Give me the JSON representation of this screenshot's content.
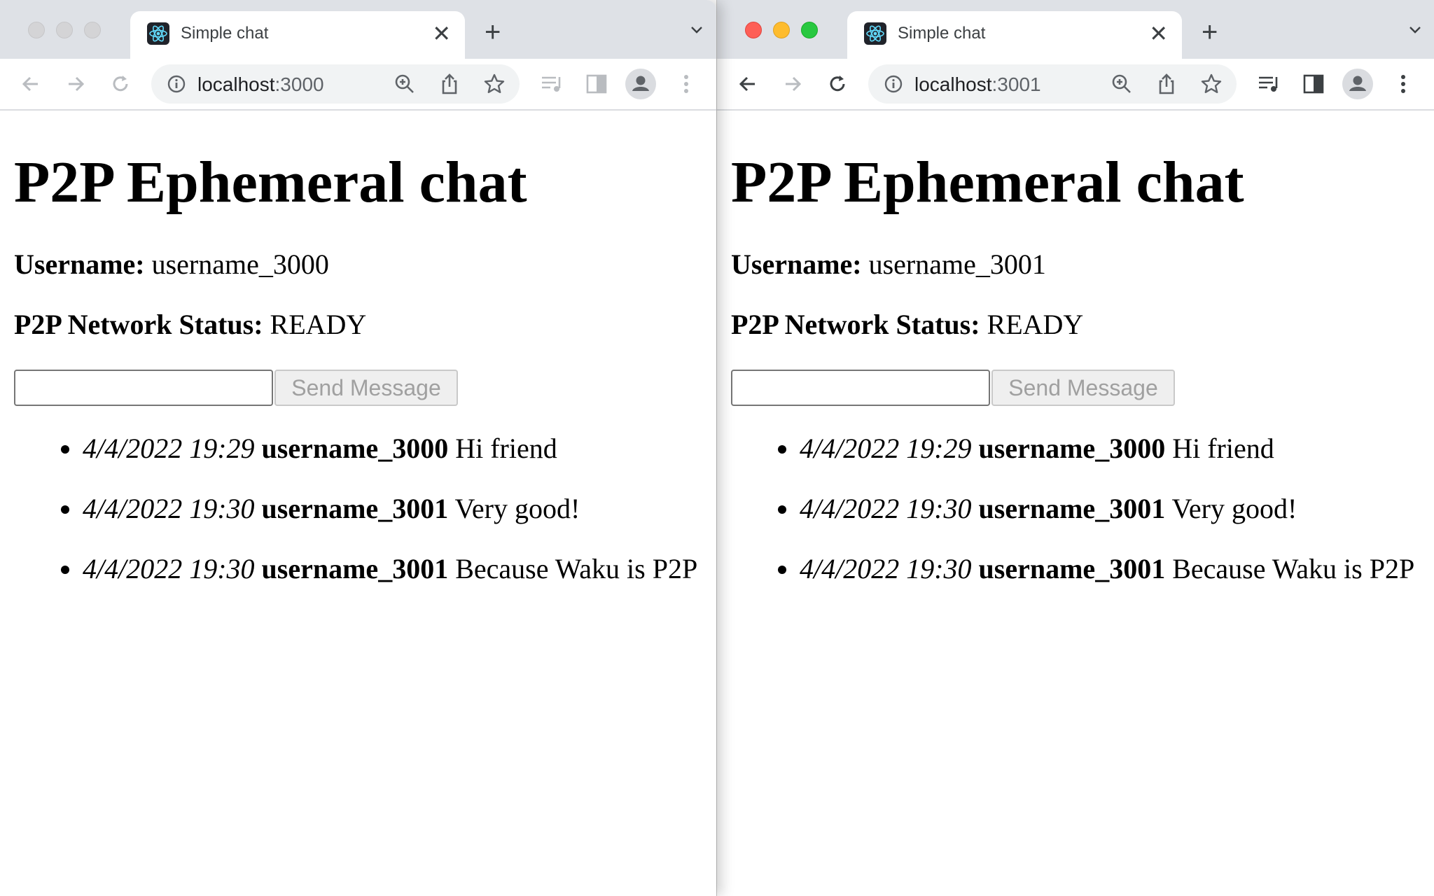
{
  "windows": [
    {
      "tab_title": "Simple chat",
      "url_host": "localhost",
      "url_port": ":3000",
      "heading": "P2P Ephemeral chat",
      "username_label": "Username:",
      "username_value": "username_3000",
      "status_label": "P2P Network Status:",
      "status_value": "READY",
      "input_value": "",
      "send_label": "Send Message",
      "messages": [
        {
          "time": "4/4/2022 19:29",
          "user": "username_3000",
          "text": "Hi friend"
        },
        {
          "time": "4/4/2022 19:30",
          "user": "username_3001",
          "text": "Very good!"
        },
        {
          "time": "4/4/2022 19:30",
          "user": "username_3001",
          "text": "Because Waku is P2P"
        }
      ]
    },
    {
      "tab_title": "Simple chat",
      "url_host": "localhost",
      "url_port": ":3001",
      "heading": "P2P Ephemeral chat",
      "username_label": "Username:",
      "username_value": "username_3001",
      "status_label": "P2P Network Status:",
      "status_value": "READY",
      "input_value": "",
      "send_label": "Send Message",
      "messages": [
        {
          "time": "4/4/2022 19:29",
          "user": "username_3000",
          "text": "Hi friend"
        },
        {
          "time": "4/4/2022 19:30",
          "user": "username_3001",
          "text": "Very good!"
        },
        {
          "time": "4/4/2022 19:30",
          "user": "username_3001",
          "text": "Because Waku is P2P"
        }
      ]
    }
  ],
  "icons": {
    "favicon": "react-logo-icon",
    "info": "info-icon",
    "zoom": "zoom-icon",
    "share": "share-icon",
    "bookmark": "star-icon",
    "media": "media-controls-icon",
    "sidepanel": "side-panel-icon",
    "profile": "profile-icon",
    "menu": "more-vertical-icon"
  },
  "colors": {
    "tabstrip_bg": "#dee1e6",
    "omnibox_bg": "#f1f3f4",
    "traffic_red": "#fe5f57",
    "traffic_yellow": "#febc2e",
    "traffic_green": "#28c840",
    "button_disabled_text": "#a0a0a0"
  }
}
